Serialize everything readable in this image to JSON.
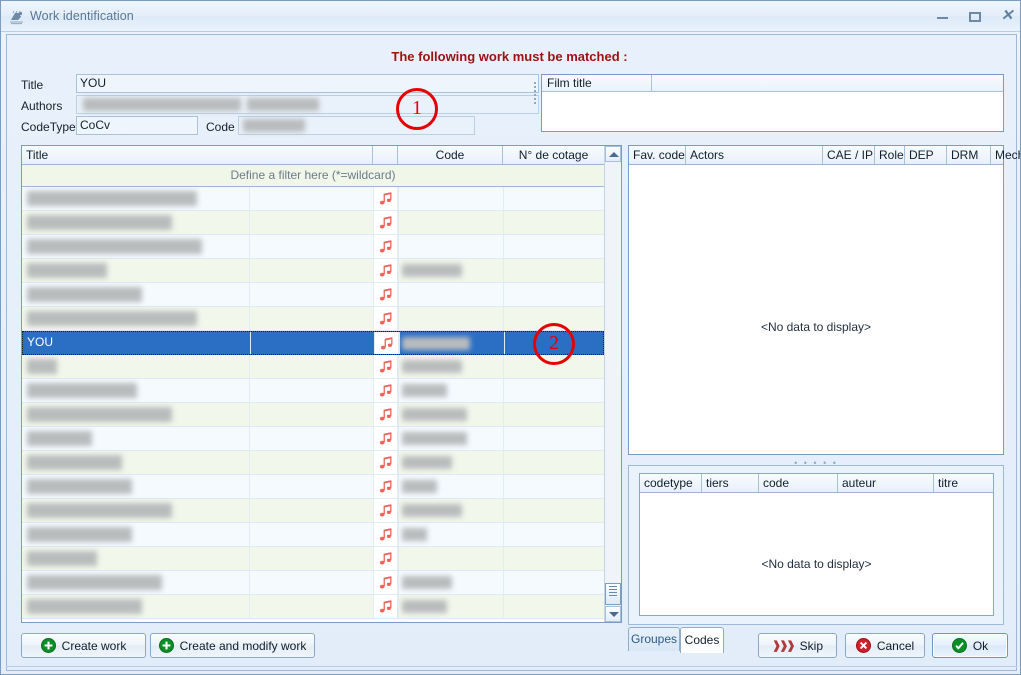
{
  "window": {
    "title": "Work identification",
    "icon": "app-icon",
    "controls": {
      "minimize": "minimize",
      "maximize": "maximize",
      "close": "close"
    }
  },
  "headline": "The following work must be matched :",
  "form": {
    "title_label": "Title",
    "title_value": "YOU",
    "authors_label": "Authors",
    "authors_value": "",
    "codetype_label": "CodeType",
    "codetype_value": "CoCv",
    "code_label": "Code",
    "code_value": ""
  },
  "film_panel": {
    "columns": [
      "Film title",
      ""
    ],
    "rows": []
  },
  "left_grid": {
    "columns": [
      "Title",
      "",
      "Code",
      "N° de cotage"
    ],
    "sort_column": "Title",
    "sort_direction": "ascending",
    "filter_placeholder": "Define a filter here (*=wildcard)",
    "selected_row_title": "YOU",
    "row_icon": "music-note-icon",
    "rows": [
      {
        "title": "",
        "code": "",
        "cotage": "",
        "selected": false
      },
      {
        "title": "",
        "code": "",
        "cotage": "",
        "selected": false
      },
      {
        "title": "",
        "code": "",
        "cotage": "",
        "selected": false
      },
      {
        "title": "",
        "code": "",
        "cotage": "",
        "selected": false
      },
      {
        "title": "",
        "code": "",
        "cotage": "",
        "selected": false
      },
      {
        "title": "",
        "code": "",
        "cotage": "",
        "selected": false
      },
      {
        "title": "YOU",
        "code": "",
        "cotage": "",
        "selected": true
      },
      {
        "title": "",
        "code": "",
        "cotage": "",
        "selected": false
      },
      {
        "title": "",
        "code": "",
        "cotage": "",
        "selected": false
      },
      {
        "title": "",
        "code": "",
        "cotage": "",
        "selected": false
      },
      {
        "title": "",
        "code": "",
        "cotage": "",
        "selected": false
      },
      {
        "title": "",
        "code": "",
        "cotage": "",
        "selected": false
      },
      {
        "title": "",
        "code": "",
        "cotage": "",
        "selected": false
      },
      {
        "title": "",
        "code": "",
        "cotage": "",
        "selected": false
      },
      {
        "title": "",
        "code": "",
        "cotage": "",
        "selected": false
      },
      {
        "title": "",
        "code": "",
        "cotage": "",
        "selected": false
      },
      {
        "title": "",
        "code": "",
        "cotage": "",
        "selected": false
      },
      {
        "title": "",
        "code": "",
        "cotage": "",
        "selected": false
      }
    ]
  },
  "actors_grid": {
    "columns": [
      "Fav. code",
      "Actors",
      "CAE / IPI",
      "Role",
      "DEP",
      "DRM",
      "Mech"
    ],
    "empty_text": "<No data to display>"
  },
  "codes_grid": {
    "columns": [
      "codetype",
      "tiers",
      "code",
      "auteur",
      "titre"
    ],
    "empty_text": "<No data to display>"
  },
  "tabs": [
    {
      "label": "Groupes",
      "active": false
    },
    {
      "label": "Codes",
      "active": true
    }
  ],
  "buttons": {
    "create_work": "Create work",
    "create_and_modify_work": "Create and modify work",
    "skip": "Skip",
    "cancel": "Cancel",
    "ok": "Ok"
  },
  "annotations": [
    {
      "label": "1"
    },
    {
      "label": "2"
    }
  ],
  "colors": {
    "headline": "#9d1111",
    "selection": "#2b6fc4",
    "music_note": "#e8675a",
    "annotation": "#e60000",
    "row_alt_green": "#f2f7ec",
    "row_alt_blue": "#f5faff",
    "filter_row": "#f0f6e8"
  }
}
